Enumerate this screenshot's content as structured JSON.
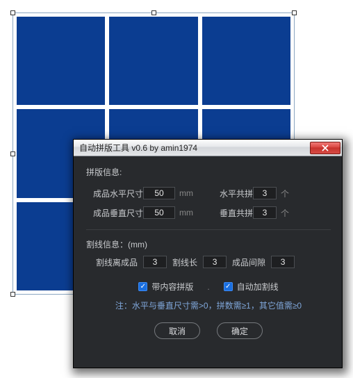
{
  "dialog": {
    "title": "自动拼版工具 v0.6   by amin1974",
    "section1_title": "拼版信息:",
    "hsize_label": "成品水平尺寸",
    "hsize_value": "50",
    "hsize_unit": "mm",
    "hcount_label": "水平共拼",
    "hcount_value": "3",
    "hcount_unit": "个",
    "vsize_label": "成品垂直尺寸",
    "vsize_value": "50",
    "vsize_unit": "mm",
    "vcount_label": "垂直共拼",
    "vcount_value": "3",
    "vcount_unit": "个",
    "section2_title": "割线信息：(mm)",
    "cut_dist_label": "割线离成品",
    "cut_dist_value": "3",
    "cut_len_label": "割线长",
    "cut_len_value": "3",
    "gap_label": "成品间隙",
    "gap_value": "3",
    "check1_label": "带内容拼版",
    "check1_checked": true,
    "check2_label": "自动加割线",
    "check2_checked": true,
    "note": "注：水平与垂直尺寸需>0，拼数需≥1，其它值需≥0",
    "cancel_label": "取消",
    "ok_label": "确定"
  }
}
